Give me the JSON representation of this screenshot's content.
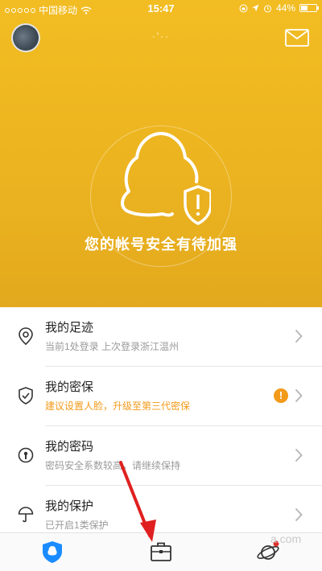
{
  "status_bar": {
    "carrier": "中国移动",
    "time": "15:47",
    "battery": "44%",
    "battery_level": 0.44
  },
  "header": {
    "nickname": "·'··"
  },
  "hero": {
    "headline": "您的帐号安全有待加强"
  },
  "list": {
    "items": [
      {
        "title": "我的足迹",
        "subtitle": "当前1处登录 上次登录浙江温州",
        "icon": "location-pin-icon"
      },
      {
        "title": "我的密保",
        "subtitle": "建议设置人脸，升级至第三代密保",
        "icon": "shield-check-icon",
        "alert": "!"
      },
      {
        "title": "我的密码",
        "subtitle": "密码安全系数较高，请继续保持",
        "icon": "keyhole-icon"
      },
      {
        "title": "我的保护",
        "subtitle": "已开启1类保护",
        "icon": "umbrella-icon"
      }
    ]
  },
  "tabbar": {
    "tabs": [
      {
        "icon": "qq-shield-icon",
        "active": true
      },
      {
        "icon": "toolbox-icon",
        "active": false
      },
      {
        "icon": "planet-icon",
        "active": false,
        "badge": true
      }
    ]
  },
  "watermark": "a.com",
  "colors": {
    "hero_bg": "#ecb420",
    "accent": "#1a8cff",
    "warning": "#f29a1a",
    "annotation_arrow": "#e02020"
  }
}
